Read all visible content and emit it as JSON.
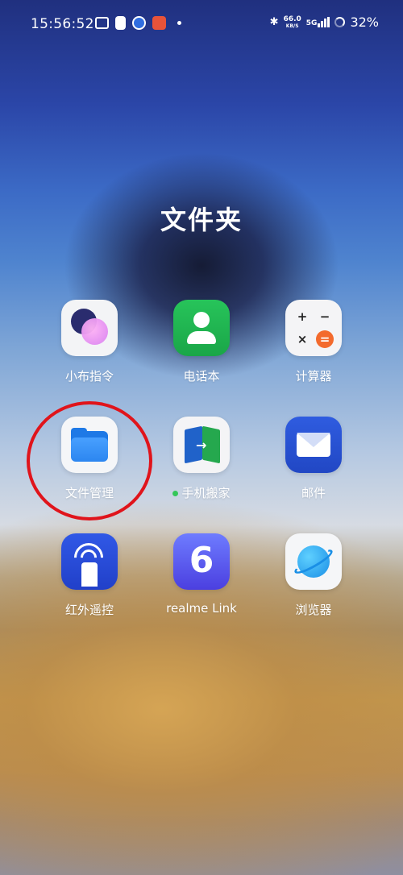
{
  "status_bar": {
    "time": "15:56:52",
    "notification_icons": [
      "tv-icon",
      "tag-icon",
      "z-app-icon",
      "taobao-icon",
      "dot-icon"
    ],
    "net_speed_value": "66.0",
    "net_speed_unit": "KB/S",
    "network": "5G",
    "battery": "32%"
  },
  "folder": {
    "title": "文件夹",
    "apps": [
      {
        "label": "小布指令",
        "icon": "xiaobu-icon"
      },
      {
        "label": "电话本",
        "icon": "contacts-icon"
      },
      {
        "label": "计算器",
        "icon": "calculator-icon"
      },
      {
        "label": "文件管理",
        "icon": "file-manager-icon"
      },
      {
        "label": "手机搬家",
        "icon": "phone-clone-icon"
      },
      {
        "label": "邮件",
        "icon": "mail-icon"
      },
      {
        "label": "红外遥控",
        "icon": "ir-remote-icon"
      },
      {
        "label": "realme Link",
        "icon": "realme-link-icon"
      },
      {
        "label": "浏览器",
        "icon": "browser-icon"
      }
    ]
  },
  "calculator_keys": [
    "+",
    "−",
    "×",
    "="
  ],
  "colors": {
    "highlight_ring": "#e0141b",
    "new_badge_dot": "#34c759"
  }
}
